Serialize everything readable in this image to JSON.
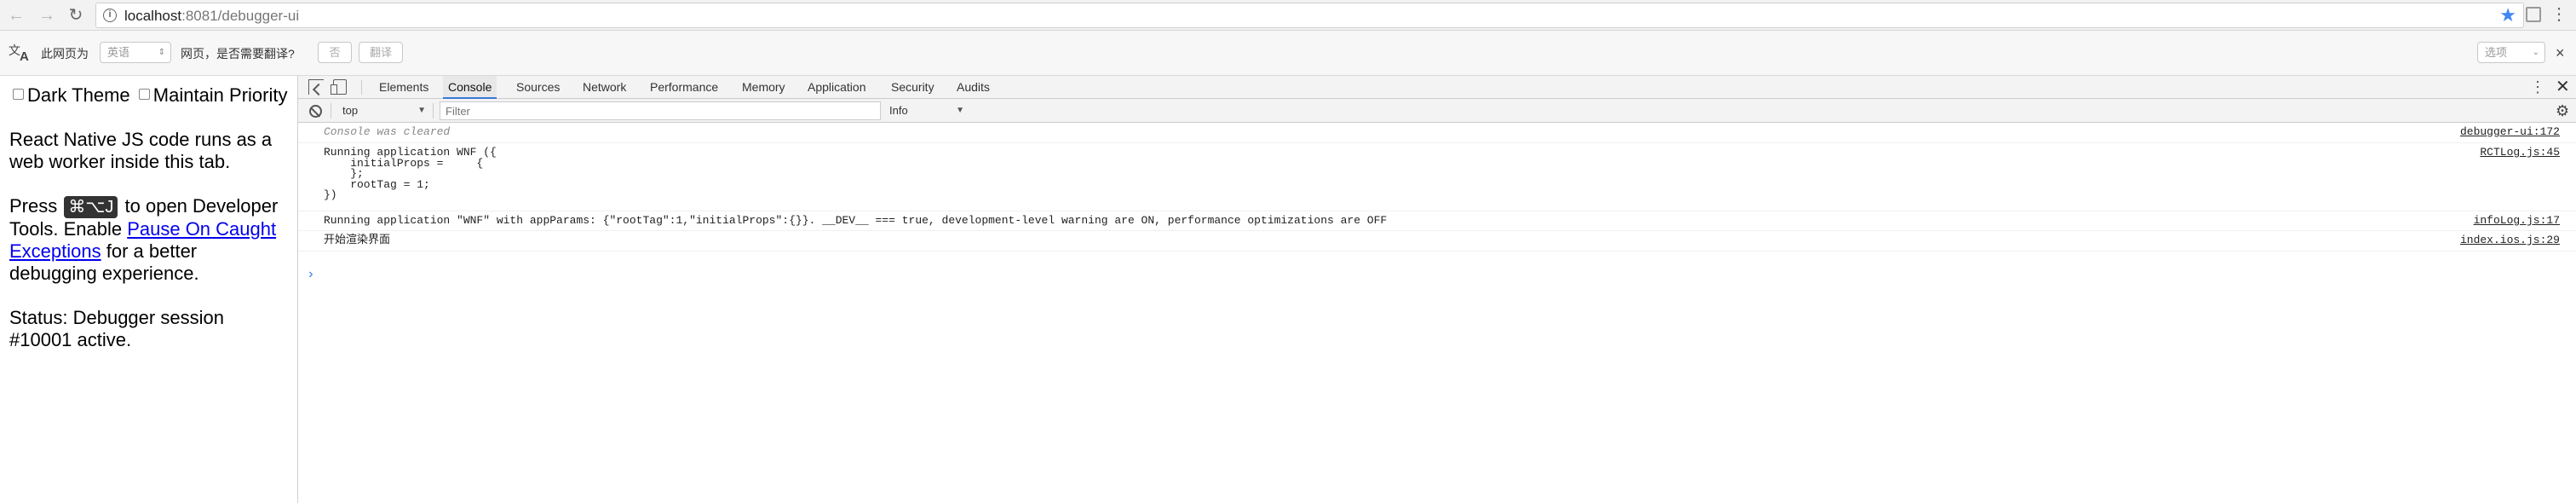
{
  "browser": {
    "url_host": "localhost",
    "url_rest": ":8081/debugger-ui"
  },
  "translate_bar": {
    "page_is_label": "此网页为",
    "source_language": "英语",
    "question": "网页，是否需要翻译?",
    "no_button": "否",
    "translate_button": "翻译",
    "options_label": "选项",
    "close": "×"
  },
  "page": {
    "dark_theme_label": "Dark Theme",
    "maintain_priority_label": "Maintain Priority",
    "intro": "React Native JS code runs as a web worker inside this tab.",
    "press_prefix": "Press ",
    "shortcut": "⌘⌥J",
    "press_middle": " to open Developer Tools. Enable ",
    "pause_link": "Pause On Caught Exceptions",
    "press_suffix": " for a better debugging experience.",
    "status": "Status: Debugger session #10001 active."
  },
  "devtools": {
    "tabs": [
      "Elements",
      "Console",
      "Sources",
      "Network",
      "Performance",
      "Memory",
      "Application",
      "Security",
      "Audits"
    ],
    "active_tab": "Console",
    "context": "top",
    "filter_placeholder": "Filter",
    "level": "Info",
    "messages": [
      {
        "text": "Console was cleared",
        "source": "debugger-ui:172"
      },
      {
        "text": "Running application WNF ({\n    initialProps =     {\n    };\n    rootTag = 1;\n})",
        "source": "RCTLog.js:45"
      },
      {
        "text": "Running application \"WNF\" with appParams: {\"rootTag\":1,\"initialProps\":{}}. __DEV__ === true, development-level warning are ON, performance optimizations are OFF",
        "source": "infoLog.js:17"
      },
      {
        "text": "开始渲染界面",
        "source": "index.ios.js:29"
      }
    ]
  }
}
